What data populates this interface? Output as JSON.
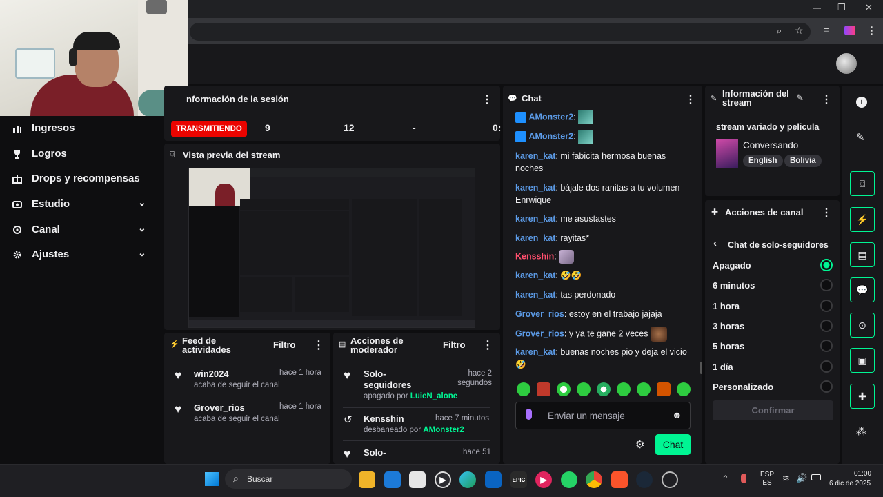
{
  "window": {
    "minimize": "—",
    "restore": "❐",
    "close": "✕"
  },
  "sidebar": {
    "items": [
      {
        "label": "Ingresos",
        "icon": "bar-chart-icon"
      },
      {
        "label": "Logros",
        "icon": "trophy-icon"
      },
      {
        "label": "Drops y recompensas",
        "icon": "gift-icon"
      },
      {
        "label": "Estudio",
        "icon": "camera-icon"
      },
      {
        "label": "Canal",
        "icon": "gear-icon"
      },
      {
        "label": "Ajustes",
        "icon": "settings-icon"
      }
    ]
  },
  "session": {
    "title": "nformación de la sesión",
    "live_badge": "TRANSMITIENDO",
    "stats": [
      "9",
      "12",
      "-",
      "0:"
    ]
  },
  "preview": {
    "title": "Vista previa del stream"
  },
  "feed": {
    "title": "Feed de actividades",
    "filter": "Filtro",
    "items": [
      {
        "user": "win2024",
        "time": "hace 1 hora",
        "desc": "acaba de seguir el canal"
      },
      {
        "user": "Grover_rios",
        "time": "hace 1 hora",
        "desc": "acaba de seguir el canal"
      }
    ]
  },
  "modactions": {
    "title": "Acciones de moderador",
    "filter": "Filtro",
    "items": [
      {
        "title": "Solo-seguidores",
        "time": "hace 2 segundos",
        "desc": "apagado por",
        "by": "LuieN_alone"
      },
      {
        "title": "Kensshin",
        "time": "hace 7 minutos",
        "desc": "desbaneado por",
        "by": "AMonster2"
      },
      {
        "title": "Solo-",
        "time": "hace 51",
        "desc": "",
        "by": ""
      }
    ]
  },
  "chat": {
    "title": "Chat",
    "messages": [
      {
        "user": "AMonster2",
        "text": ""
      },
      {
        "user": "AMonster2",
        "text": ""
      },
      {
        "user": "karen_kat",
        "text": "mi fabicita hermosa buenas noches"
      },
      {
        "user": "karen_kat",
        "text": "bájale dos ranitas a tu volumen Enrwique"
      },
      {
        "user": "karen_kat",
        "text": "me asustastes"
      },
      {
        "user": "karen_kat",
        "text": "rayitas*"
      },
      {
        "user": "Kensshin",
        "text": ""
      },
      {
        "user": "karen_kat",
        "text": "🤣🤣"
      },
      {
        "user": "karen_kat",
        "text": "tas perdonado"
      },
      {
        "user": "Grover_rios",
        "text": "estoy en el trabajo jajaja"
      },
      {
        "user": "Grover_rios",
        "text": "y ya te gane 2 veces"
      },
      {
        "user": "karen_kat",
        "text": "buenas noches pio y deja el vicio 🤣"
      }
    ],
    "input_placeholder": "Enviar un mensaje",
    "send_button": "Chat"
  },
  "stream_info": {
    "title": "Información del stream",
    "stream_title": "stream variado y pelicula",
    "category": "Conversando",
    "tags": [
      "English",
      "Bolivia"
    ]
  },
  "channel_actions": {
    "title": "Acciones de canal",
    "sub_title": "Chat de solo-seguidores",
    "options": [
      "Apagado",
      "6 minutos",
      "1 hora",
      "3 horas",
      "5 horas",
      "1 día",
      "Personalizado"
    ],
    "selected": "Apagado",
    "confirm": "Confirmar"
  },
  "taskbar": {
    "search": "Buscar",
    "lang1": "ESP",
    "lang2": "ES",
    "time": "01:00",
    "date": "6 dic de 2025"
  },
  "colors": {
    "accent": "#00f593",
    "live": "#eb0400",
    "bg": "#0e0e10",
    "panel": "#18181b"
  }
}
